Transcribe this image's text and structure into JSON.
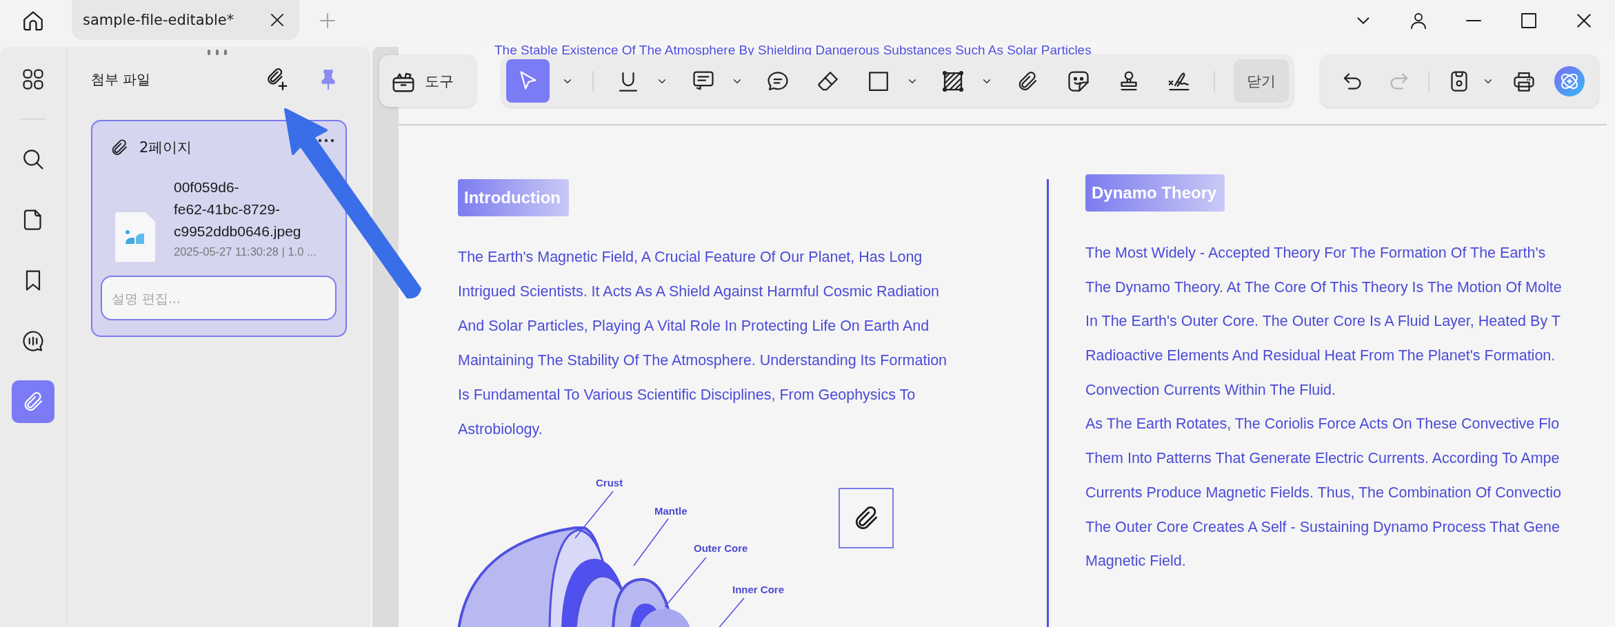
{
  "tab_bar": {
    "tabs": [
      {
        "label": "sample-file-editable*",
        "selected": true
      }
    ]
  },
  "rail": [
    {
      "kind": "grid",
      "selected": false
    },
    {
      "kind": "separator"
    },
    {
      "kind": "search",
      "selected": false
    },
    {
      "kind": "page",
      "selected": false
    },
    {
      "kind": "bookmark",
      "selected": false
    },
    {
      "kind": "comment",
      "selected": false
    },
    {
      "kind": "attachment",
      "selected": true
    }
  ],
  "attachments_panel": {
    "title": "첨부 파일",
    "pinned": true,
    "groups": [
      {
        "page": "2페이지",
        "selected": true,
        "files": [
          {
            "name_lines": [
              "00f059d6-",
              "fe62-41bc-8729-",
              "c9952ddb0646.jpeg"
            ],
            "meta": "2025-05-27 11:30:28 | 1.0 ...",
            "description": {
              "placeholder": "설명 편집..."
            }
          }
        ]
      }
    ]
  },
  "toolbar": {
    "tools_button": "도구",
    "tools": [
      {
        "kind": "select",
        "selected": true,
        "dropdown": true
      },
      {
        "kind": "separator"
      },
      {
        "kind": "underline",
        "selected": false,
        "dropdown": true
      },
      {
        "kind": "note",
        "selected": false,
        "dropdown": true
      },
      {
        "kind": "comment",
        "selected": false,
        "dropdown": false
      },
      {
        "kind": "eraser",
        "selected": false,
        "dropdown": false
      },
      {
        "kind": "rectangle",
        "selected": false,
        "dropdown": true
      },
      {
        "kind": "area",
        "selected": false,
        "dropdown": true
      },
      {
        "kind": "attachment",
        "selected": false,
        "dropdown": false
      },
      {
        "kind": "sticker",
        "selected": false,
        "dropdown": false
      },
      {
        "kind": "stamp",
        "selected": false,
        "dropdown": false
      },
      {
        "kind": "signature",
        "selected": false,
        "dropdown": false
      },
      {
        "kind": "separator"
      }
    ],
    "close_button": "닫기",
    "actions": [
      {
        "kind": "undo",
        "disabled": false,
        "dropdown": false
      },
      {
        "kind": "redo",
        "disabled": true,
        "dropdown": false
      },
      {
        "kind": "separator"
      },
      {
        "kind": "save",
        "disabled": false,
        "dropdown": true
      },
      {
        "kind": "print",
        "disabled": false,
        "dropdown": false
      },
      {
        "kind": "ai",
        "disabled": false,
        "dropdown": false
      }
    ]
  },
  "document": {
    "running_text": "The Stable Existence Of The Atmosphere By Shielding Dangerous Substances Such As Solar Particles",
    "sections": [
      {
        "heading": "Introduction",
        "lines": [
          "The Earth's Magnetic Field, A Crucial Feature Of Our Planet, Has Long",
          "Intrigued Scientists. It Acts As A Shield Against Harmful Cosmic Radiation",
          "And Solar Particles, Playing A Vital Role In Protecting Life On Earth And",
          "Maintaining The Stability Of The Atmosphere. Understanding Its Formation",
          "Is Fundamental To Various Scientific Disciplines, From Geophysics To",
          "Astrobiology."
        ]
      },
      {
        "heading": "Dynamo Theory",
        "lines": [
          "The Most Widely - Accepted Theory For The Formation Of The Earth's",
          "The Dynamo Theory. At The Core Of This Theory Is The Motion Of Molte",
          "In The Earth's Outer Core. The Outer Core Is A Fluid Layer, Heated By T",
          "Radioactive Elements And Residual Heat From The Planet's Formation.",
          "Convection Currents Within The Fluid.",
          "As The Earth Rotates, The Coriolis Force Acts On These Convective Flo",
          "Them Into Patterns That Generate Electric Currents. According To Ampe",
          "Currents Produce Magnetic Fields. Thus, The Combination Of Convectio",
          "The Outer Core Creates A Self - Sustaining Dynamo Process That Gene",
          "Magnetic Field."
        ]
      }
    ],
    "diagram": {
      "labels": [
        "Crust",
        "Mantle",
        "Outer Core",
        "Inner Core"
      ]
    }
  }
}
